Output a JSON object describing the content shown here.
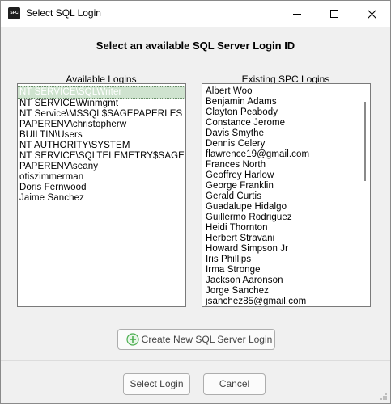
{
  "window": {
    "title": "Select SQL Login",
    "icon_text": "SPC"
  },
  "heading": "Select an available SQL Server Login ID",
  "available": {
    "label": "Available Logins",
    "items": [
      "NT SERVICE\\SQLWriter",
      "NT SERVICE\\Winmgmt",
      "NT Service\\MSSQL$SAGEPAPERLES",
      "PAPERENV\\christopherw",
      "BUILTIN\\Users",
      "NT AUTHORITY\\SYSTEM",
      "NT SERVICE\\SQLTELEMETRY$SAGE",
      "PAPERENV\\seany",
      "otiszimmerman",
      "Doris Fernwood",
      "Jaime Sanchez"
    ],
    "selected_index": 0
  },
  "existing": {
    "label": "Existing SPC Logins",
    "items": [
      "Albert Woo",
      "Benjamin Adams",
      "Clayton Peabody",
      "Constance Jerome",
      "Davis Smythe",
      "Dennis Celery",
      "flawrence19@gmail.com",
      "Frances North",
      "Geoffrey Harlow",
      "George Franklin",
      "Gerald Curtis",
      "Guadalupe Hidalgo",
      "Guillermo Rodriguez",
      "Heidi Thornton",
      "Herbert Stravani",
      "Howard Simpson Jr",
      "Iris Phillips",
      "Irma Stronge",
      "Jackson Aaronson",
      "Jorge Sanchez",
      "jsanchez85@gmail.com"
    ]
  },
  "buttons": {
    "create": "Create New SQL Server Login",
    "select": "Select Login",
    "cancel": "Cancel"
  },
  "colors": {
    "selection": "#cfe3cf",
    "plus_icon": "#4caf50"
  }
}
